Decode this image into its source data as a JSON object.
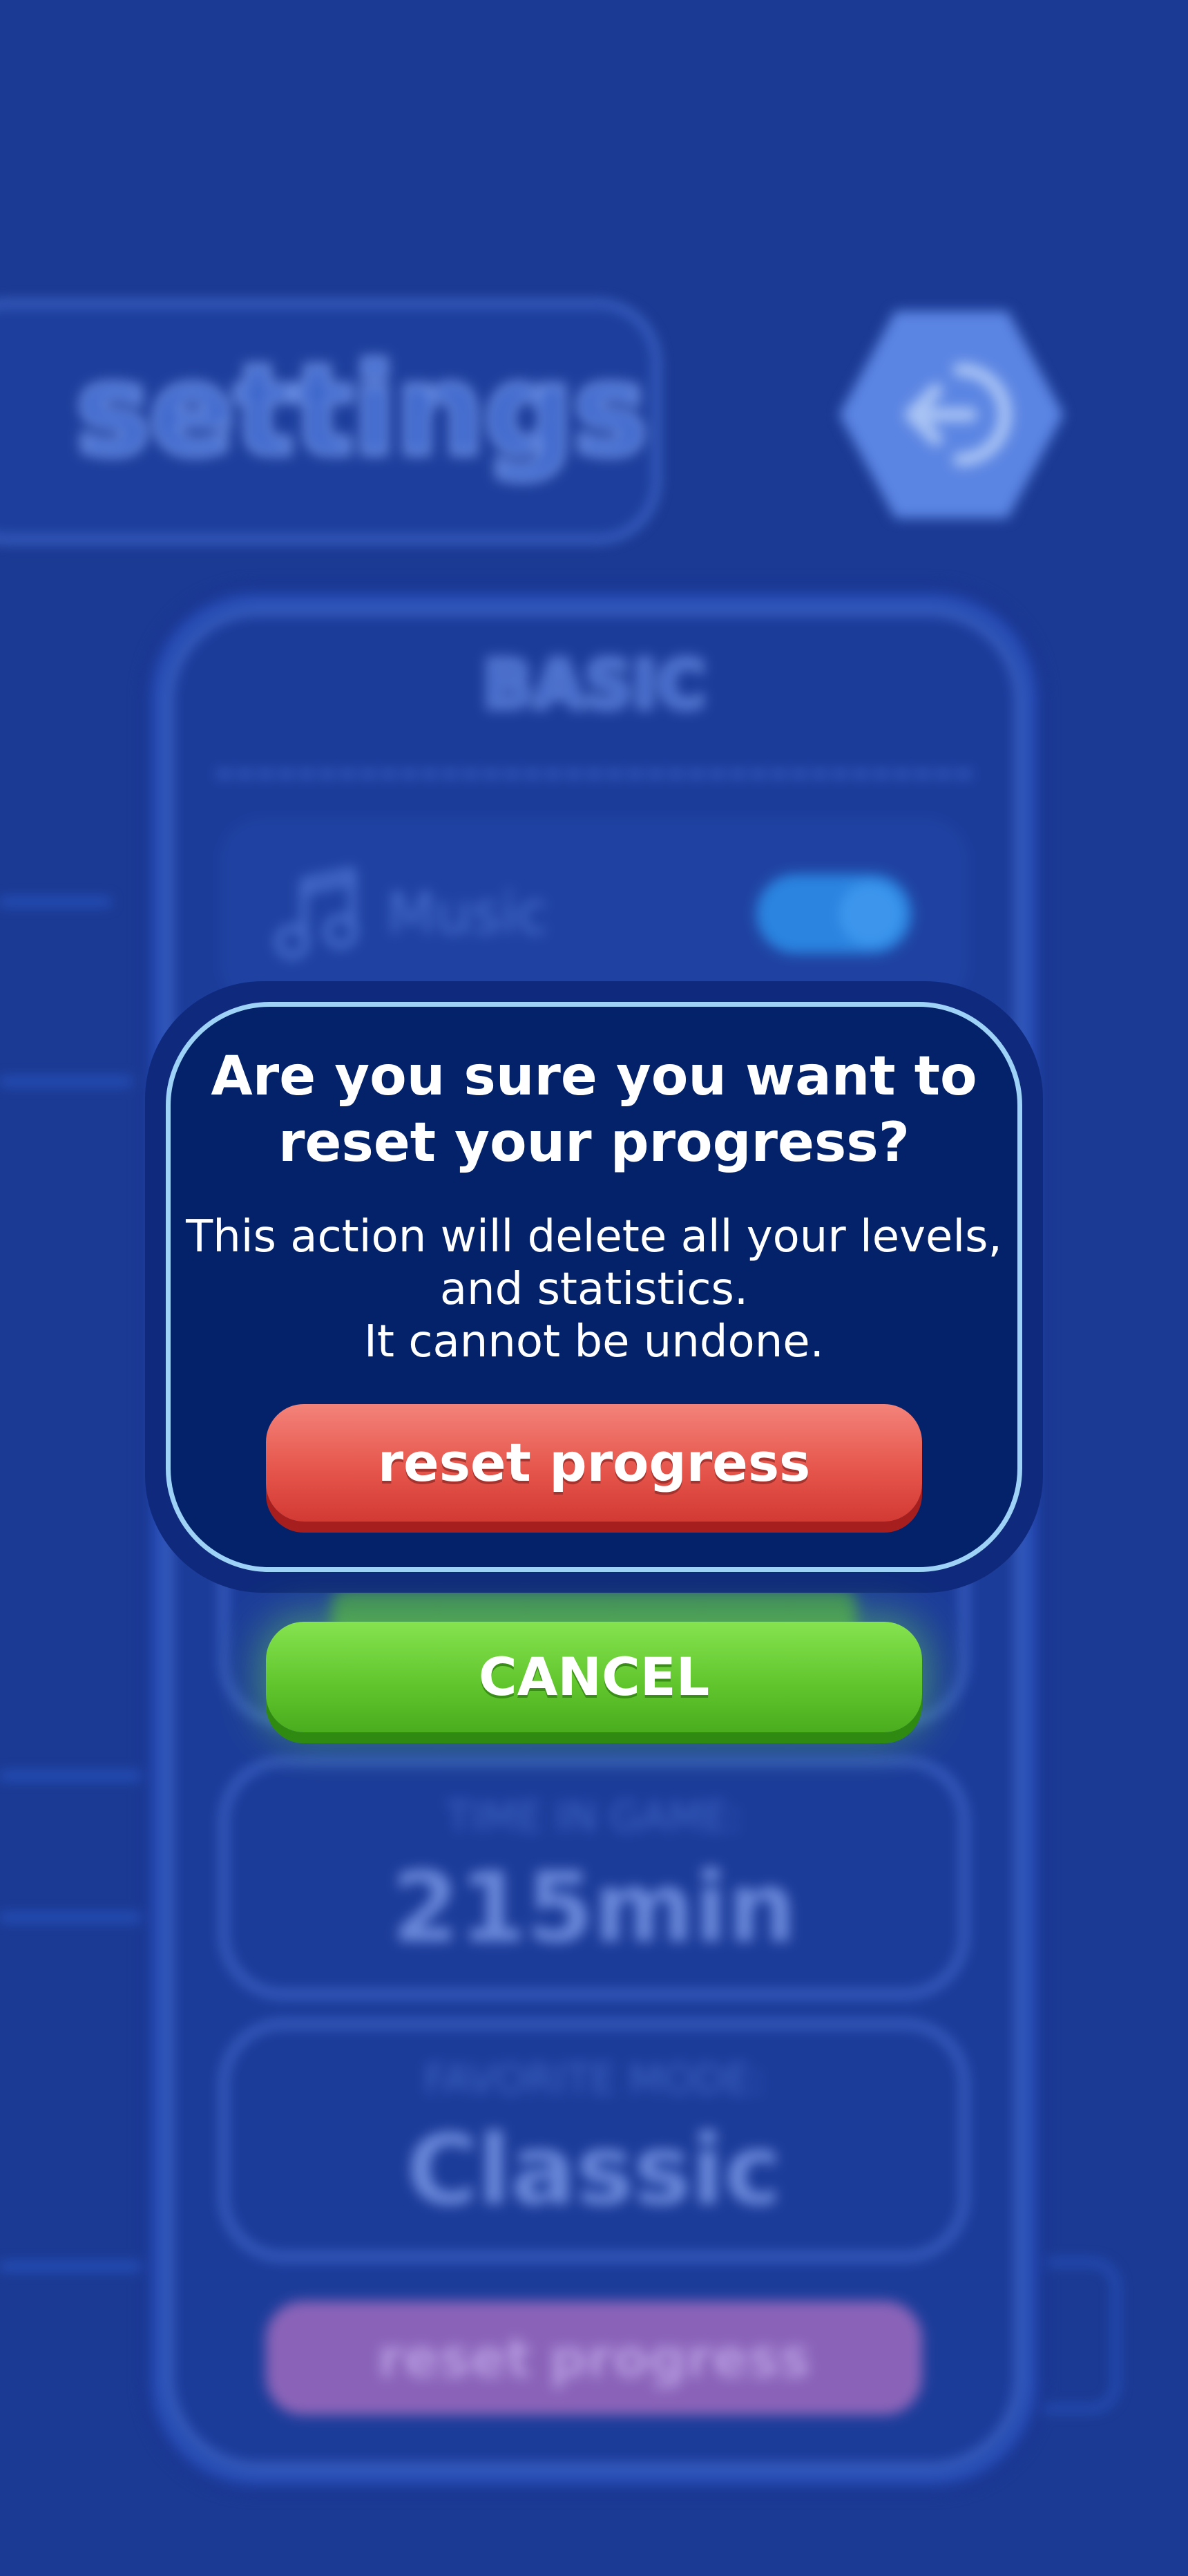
{
  "background_screen": {
    "title": "settings",
    "back_button_icon": "back-arrow-icon",
    "section_label": "BASIC",
    "music": {
      "label": "Music",
      "icon": "music-note-icon",
      "toggle_on": true
    },
    "stats": [
      {
        "label": "TIME IN GAME:",
        "value": "215min"
      },
      {
        "label": "FAVORITE MODE:",
        "value": "Classic"
      }
    ],
    "reset_button_label": "reset progress"
  },
  "dialog": {
    "title_line1": "Are you sure you want to",
    "title_line2": "reset your progress?",
    "body_line1": "This action will delete all your levels,",
    "body_line2": "and statistics.",
    "body_line3": "It cannot be undone.",
    "confirm_label": "reset progress",
    "cancel_label": "CANCEL"
  },
  "colors": {
    "background": "#1b3a94",
    "dialog_bg": "#04226a",
    "dialog_border": "#9ed2f7",
    "reset_button": "#e6564c",
    "cancel_button": "#5fc42c"
  }
}
